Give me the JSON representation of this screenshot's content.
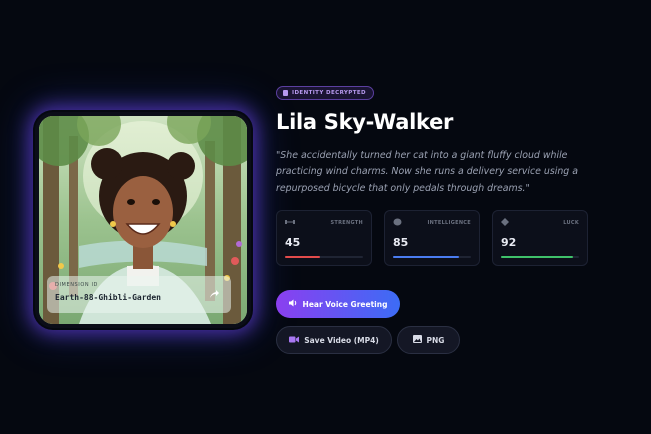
{
  "badge": {
    "text": "IDENTITY DECRYPTED",
    "icon": "file-icon"
  },
  "name": "Lila Sky-Walker",
  "quote": "\"She accidentally turned her cat into a giant fluffy cloud while practicing wind charms. Now she runs a delivery service using a repurposed bicycle that only pedals through dreams.\"",
  "card": {
    "dimension_label": "DIMENSION ID",
    "dimension_value": "Earth-88-Ghibli-Garden",
    "share_icon": "share-arrow-icon"
  },
  "stats": [
    {
      "label": "STRENGTH",
      "value": "45",
      "fill": 0.45,
      "color": "#e24b4b",
      "icon": "dumbbell-icon"
    },
    {
      "label": "INTELLIGENCE",
      "value": "85",
      "fill": 0.85,
      "color": "#4a7cf0",
      "icon": "brain-icon"
    },
    {
      "label": "LUCK",
      "value": "92",
      "fill": 0.92,
      "color": "#3fc16a",
      "icon": "clover-icon"
    }
  ],
  "buttons": {
    "voice": {
      "label": "Hear Voice Greeting",
      "icon": "speaker-icon"
    },
    "video": {
      "label": "Save Video (MP4)",
      "icon": "video-camera-icon"
    },
    "png": {
      "label": "PNG",
      "icon": "image-icon"
    }
  },
  "colors": {
    "background": "#050810",
    "accent_purple": "#8b3ff0",
    "accent_blue": "#3c6cf5"
  }
}
